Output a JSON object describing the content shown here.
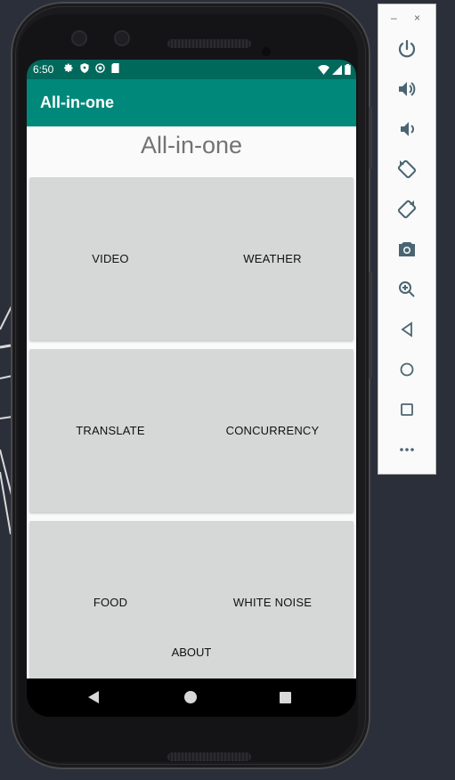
{
  "status_bar": {
    "time": "6:50",
    "left_icons": [
      "gear-icon",
      "shield-icon",
      "circle-a-icon",
      "sd-card-icon"
    ],
    "right_icons": [
      "wifi-icon",
      "signal-icon",
      "battery-icon"
    ]
  },
  "app_bar": {
    "title": "All-in-one",
    "color": "#00897b"
  },
  "main": {
    "heading": "All-in-one",
    "buttons": [
      {
        "label": "VIDEO"
      },
      {
        "label": "WEATHER"
      },
      {
        "label": "TRANSLATE"
      },
      {
        "label": "CONCURRENCY"
      },
      {
        "label": "FOOD"
      },
      {
        "label": "WHITE NOISE"
      }
    ],
    "about_label": "ABOUT"
  },
  "nav_bar": {
    "icons": [
      "back-icon",
      "home-icon",
      "recents-icon"
    ]
  },
  "emulator_toolbar": {
    "window_controls": {
      "minimize": "–",
      "close": "×"
    },
    "icons": [
      "power-icon",
      "volume-up-icon",
      "volume-down-icon",
      "rotate-left-icon",
      "rotate-right-icon",
      "camera-icon",
      "zoom-icon",
      "back-icon",
      "home-icon",
      "overview-icon",
      "more-icon"
    ]
  },
  "colors": {
    "status_bar": "#00695c",
    "app_bar": "#00897b",
    "button_bg": "#d6d7d7",
    "toolbar_icon": "#4a6572"
  }
}
